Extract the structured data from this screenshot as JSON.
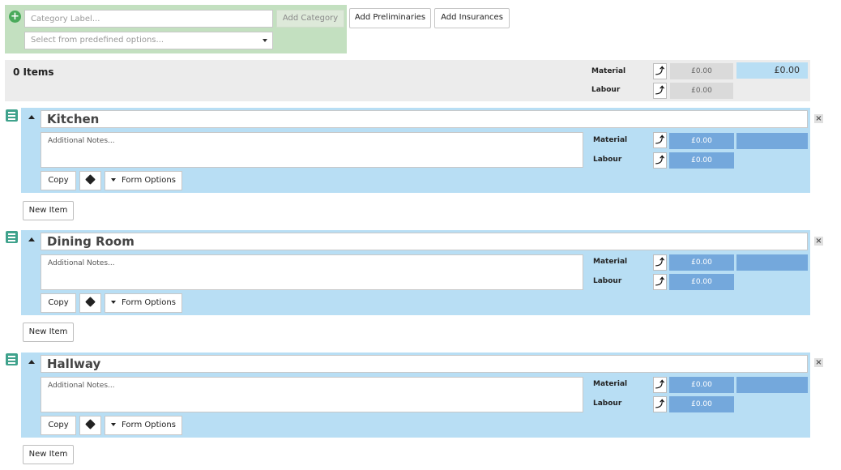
{
  "add_category": {
    "label_placeholder": "Category Label...",
    "add_button": "Add Category",
    "select_placeholder": "Select from predefined options...",
    "add_preliminaries": "Add Preliminaries",
    "add_insurances": "Add Insurances"
  },
  "totals": {
    "items_count": "0 Items",
    "material_label": "Material",
    "labour_label": "Labour",
    "material_value": "£0.00",
    "labour_value": "£0.00",
    "grand_total": "£0.00",
    "arrow_glyph": "⤴"
  },
  "categories": [
    {
      "title": "Kitchen",
      "notes_placeholder": "Additional Notes...",
      "material_label": "Material",
      "labour_label": "Labour",
      "material_value": "£0.00",
      "labour_value": "£0.00",
      "copy_label": "Copy",
      "form_options_label": "Form Options",
      "new_item_label": "New Item"
    },
    {
      "title": "Dining Room",
      "notes_placeholder": "Additional Notes...",
      "material_label": "Material",
      "labour_label": "Labour",
      "material_value": "£0.00",
      "labour_value": "£0.00",
      "copy_label": "Copy",
      "form_options_label": "Form Options",
      "new_item_label": "New Item"
    },
    {
      "title": "Hallway",
      "notes_placeholder": "Additional Notes...",
      "material_label": "Material",
      "labour_label": "Labour",
      "material_value": "£0.00",
      "labour_value": "£0.00",
      "copy_label": "Copy",
      "form_options_label": "Form Options",
      "new_item_label": "New Item"
    }
  ],
  "icons": {
    "plus": "+",
    "close": "×",
    "arrow": "⤴"
  },
  "colors": {
    "category_bg": "#b8def4",
    "value_blue": "#74a8dc",
    "add_panel_bg": "#c3e0c0",
    "menu_icon": "#3fa28c",
    "totals_bg": "#ececec"
  }
}
